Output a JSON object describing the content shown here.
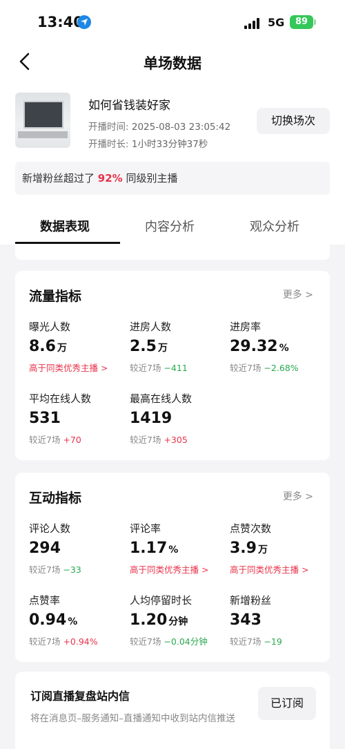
{
  "status_bar": {
    "time": "13:40",
    "network": "5G",
    "battery": "89"
  },
  "nav": {
    "title": "单场数据"
  },
  "live": {
    "name": "如何省钱装好家",
    "start_label": "开播时间:",
    "start_value": "2025-08-03 23:05:42",
    "duration_label": "开播时长:",
    "duration_value": "1小时33分钟37秒",
    "switch_label": "切换场次"
  },
  "fans_banner": {
    "prefix": "新增粉丝超过了",
    "percent": "92%",
    "suffix": "同级别主播"
  },
  "tabs": [
    {
      "label": "数据表现",
      "active": true
    },
    {
      "label": "内容分析",
      "active": false
    },
    {
      "label": "观众分析",
      "active": false
    }
  ],
  "traffic": {
    "title": "流量指标",
    "more": "更多",
    "metrics": [
      {
        "label": "曝光人数",
        "value": "8.6",
        "unit": "万",
        "hint": "高于同类优秀主播"
      },
      {
        "label": "进房人数",
        "value": "2.5",
        "unit": "万",
        "sub_label": "较近7场",
        "sub_delta": "−411",
        "dir": "down"
      },
      {
        "label": "进房率",
        "value": "29.32",
        "unit": "%",
        "sub_label": "较近7场",
        "sub_delta": "−2.68%",
        "dir": "down"
      },
      {
        "label": "平均在线人数",
        "value": "531",
        "unit": "",
        "sub_label": "较近7场",
        "sub_delta": "+70",
        "dir": "up"
      },
      {
        "label": "最高在线人数",
        "value": "1419",
        "unit": "",
        "sub_label": "较近7场",
        "sub_delta": "+305",
        "dir": "up"
      }
    ]
  },
  "interaction": {
    "title": "互动指标",
    "more": "更多",
    "metrics": [
      {
        "label": "评论人数",
        "value": "294",
        "unit": "",
        "sub_label": "较近7场",
        "sub_delta": "−33",
        "dir": "down"
      },
      {
        "label": "评论率",
        "value": "1.17",
        "unit": "%",
        "hint": "高于同类优秀主播"
      },
      {
        "label": "点赞次数",
        "value": "3.9",
        "unit": "万",
        "hint": "高于同类优秀主播"
      },
      {
        "label": "点赞率",
        "value": "0.94",
        "unit": "%",
        "sub_label": "较近7场",
        "sub_delta": "+0.94%",
        "dir": "up"
      },
      {
        "label": "人均停留时长",
        "value": "1.20",
        "unit": "分钟",
        "sub_label": "较近7场",
        "sub_delta": "−0.04分钟",
        "dir": "down"
      },
      {
        "label": "新增粉丝",
        "value": "343",
        "unit": "",
        "sub_label": "较近7场",
        "sub_delta": "−19",
        "dir": "down"
      }
    ]
  },
  "subscribe": {
    "title": "订阅直播复盘站内信",
    "desc": "将在消息页–服务通知–直播通知中收到站内信推送",
    "button": "已订阅"
  },
  "colors": {
    "accent_red": "#e8334b",
    "down_green": "#2aa84e",
    "battery_green": "#34c759"
  }
}
